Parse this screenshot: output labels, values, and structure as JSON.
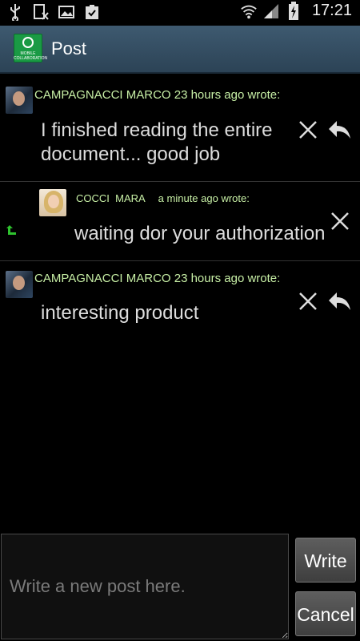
{
  "status_bar": {
    "time": "17:21",
    "icons": [
      "usb-icon",
      "sim-card-icon",
      "gallery-icon",
      "clipboard-check-icon",
      "wifi-icon",
      "signal-icon",
      "battery-charging-icon"
    ]
  },
  "action_bar": {
    "title": "Post",
    "logo_text_line1": "MOBILE",
    "logo_text_line2": "COLLABORATION"
  },
  "posts": [
    {
      "header": "CAMPAGNACCI MARCO 23 hours ago wrote:",
      "text_line1": "I finished reading the entire",
      "text_line2": "document... good job"
    },
    {
      "author": "COCCI  MARA",
      "time": "a minute ago wrote:",
      "text": "waiting dor your authorization"
    },
    {
      "header": "CAMPAGNACCI MARCO 23 hours ago wrote:",
      "text": "interesting product"
    }
  ],
  "composer": {
    "placeholder": "Write a new post here.",
    "value": "",
    "write_label": "Write",
    "cancel_label": "Cancel"
  },
  "colors": {
    "header_text": "#c8f0a6",
    "action_bar": "#3e5a70",
    "reply_arrow": "#2ec22e"
  }
}
